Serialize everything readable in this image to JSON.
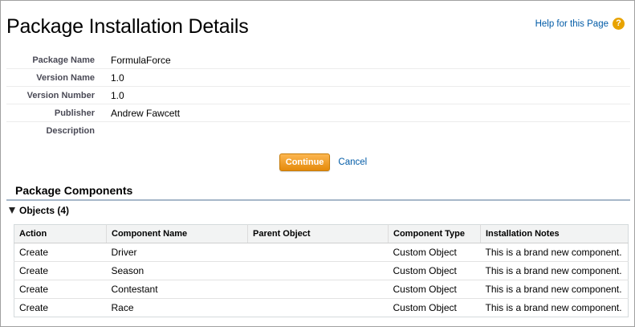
{
  "page": {
    "title": "Package Installation Details",
    "help_link": "Help for this Page",
    "help_icon": "?"
  },
  "details": [
    {
      "label": "Package Name",
      "value": "FormulaForce"
    },
    {
      "label": "Version Name",
      "value": "1.0"
    },
    {
      "label": "Version Number",
      "value": "1.0"
    },
    {
      "label": "Publisher",
      "value": "Andrew Fawcett"
    },
    {
      "label": "Description",
      "value": ""
    }
  ],
  "actions": {
    "continue_label": "Continue",
    "cancel_label": "Cancel"
  },
  "components": {
    "section_title": "Package Components",
    "group_title": "Objects (4)",
    "columns": [
      "Action",
      "Component Name",
      "Parent Object",
      "Component Type",
      "Installation Notes"
    ],
    "rows": [
      [
        "Create",
        "Driver",
        "",
        "Custom Object",
        "This is a brand new component."
      ],
      [
        "Create",
        "Season",
        "",
        "Custom Object",
        "This is a brand new component."
      ],
      [
        "Create",
        "Contestant",
        "",
        "Custom Object",
        "This is a brand new component."
      ],
      [
        "Create",
        "Race",
        "",
        "Custom Object",
        "This is a brand new component."
      ]
    ]
  },
  "colors": {
    "link": "#015ba7",
    "button_top": "#fcb650",
    "button_bottom": "#e58a0b",
    "section_rule": "#a7b7c9"
  }
}
